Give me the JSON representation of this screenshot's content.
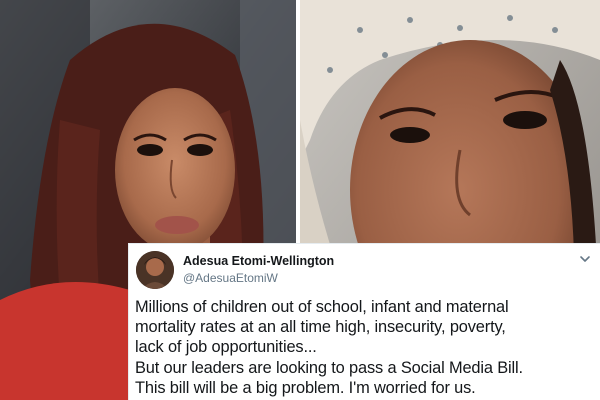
{
  "photos": {
    "left": {
      "icon": "portrait-photo-braids"
    },
    "right": {
      "icon": "portrait-photo-headscarf"
    }
  },
  "tweet": {
    "author_name": "Adesua Etomi-Wellington",
    "author_handle": "@AdesuaEtomiW",
    "menu_icon": "chevron-down-icon",
    "lines": [
      "Millions of children out of school, infant and maternal",
      "mortality rates at an all time high, insecurity, poverty,",
      "lack of job opportunities...",
      "But our leaders are looking to pass a Social Media Bill.",
      "This bill will be a big problem. I'm worried for us."
    ]
  },
  "colors": {
    "text": "#14171a",
    "handle": "#657786",
    "border": "#e6ecf0"
  }
}
